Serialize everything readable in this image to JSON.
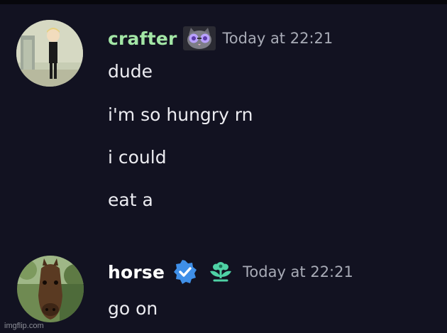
{
  "messages": [
    {
      "author": "crafter",
      "author_color": "#a3e6a6",
      "timestamp": "Today at 22:21",
      "badge_icon": "cat-sunglasses-icon",
      "lines": [
        "dude",
        "i'm so hungry rn",
        "i could",
        "eat a"
      ]
    },
    {
      "author": "horse",
      "author_color": "#ffffff",
      "timestamp": "Today at 22:21",
      "badge_icons": [
        "verified-check-icon",
        "flower-badge-icon"
      ],
      "lines": [
        "go on"
      ]
    }
  ],
  "watermark": "imgflip.com",
  "colors": {
    "background": "#121221",
    "timestamp": "#a8abb6",
    "verified_badge": "#3f8fe8",
    "flower_badge": "#4fd1a5"
  }
}
